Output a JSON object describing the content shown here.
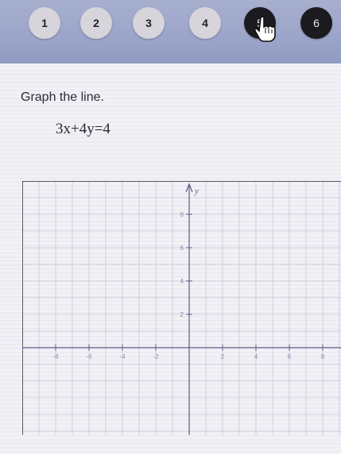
{
  "nav": {
    "questions": [
      {
        "label": "1",
        "current": false
      },
      {
        "label": "2",
        "current": false
      },
      {
        "label": "3",
        "current": false
      },
      {
        "label": "4",
        "current": false
      },
      {
        "label": "5",
        "current": true
      },
      {
        "label": "6",
        "current": false
      }
    ],
    "cursor": "hand-pointer-icon"
  },
  "question": {
    "instruction": "Graph the line.",
    "equation": "3x+4y=4"
  },
  "graph": {
    "y_axis_label": "y",
    "y_ticks": [
      "8",
      "6",
      "4",
      "2"
    ],
    "x_ticks": [
      "-8",
      "-6",
      "-4",
      "-2",
      "2",
      "4",
      "6",
      "8"
    ]
  },
  "colors": {
    "header": "#99a3c8",
    "button": "#d7d4dc",
    "current_button": "#1b1b1f",
    "grid": "#c9c7d6",
    "axis": "#5a5f86"
  }
}
